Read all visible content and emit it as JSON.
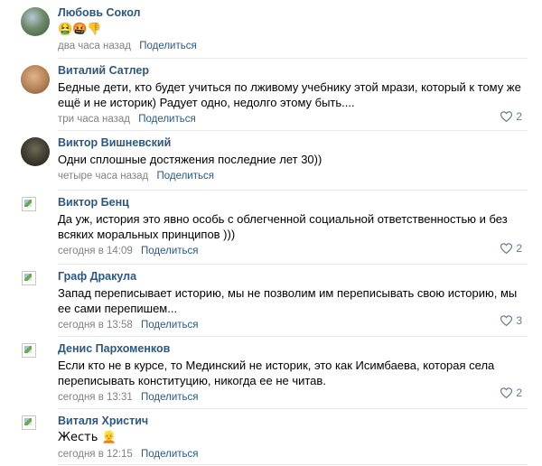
{
  "comments": [
    {
      "author": "Любовь Сокол",
      "text": "🤮🤬👎",
      "time": "два часа назад",
      "share": "Поделиться",
      "likes": ""
    },
    {
      "author": "Виталий Сатлер",
      "text": "Бедные дети, кто будет учиться по лживому учебнику этой мрази, который к тому же ещё и не историк) Радует одно, недолго этому быть....",
      "time": "три часа назад",
      "share": "Поделиться",
      "likes": "2"
    },
    {
      "author": "Виктор Вишневский",
      "text": "Одни сплошные достяжения последние лет 30))",
      "time": "четыре часа назад",
      "share": "Поделиться",
      "likes": ""
    },
    {
      "author": "Виктор Бенц",
      "text": "Да уж, история это явно особь с облегченной социальной ответственностью и без всяких моральных принципов )))",
      "time": "сегодня в 14:09",
      "share": "Поделиться",
      "likes": "2"
    },
    {
      "author": "Граф Дракула",
      "text": "Запад переписывает историю, мы не позволим им переписывать свою историю, мы ее сами перепишем...",
      "time": "сегодня в 13:58",
      "share": "Поделиться",
      "likes": "3"
    },
    {
      "author": "Денис Пархоменков",
      "text": "Если кто не в курсе, то Мединский не историк, это как Исимбаева, которая села переписывать конституцию, никогда ее не читав.",
      "time": "сегодня в 13:31",
      "share": "Поделиться",
      "likes": "2"
    },
    {
      "author": "Виталя Христич",
      "text": "Жесть 👱",
      "time": "сегодня в 12:15",
      "share": "Поделиться",
      "likes": ""
    }
  ],
  "icons": {
    "like": "heart-outline-icon"
  },
  "colors": {
    "author": "#2a5885",
    "meta": "#828282",
    "separator": "#e7e8ec"
  }
}
